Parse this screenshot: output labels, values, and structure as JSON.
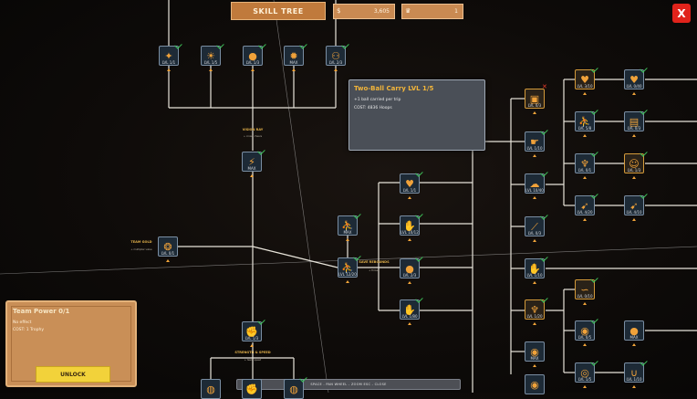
{
  "header": {
    "skill_tree_label": "SKILL TREE",
    "money": "3,605",
    "trophies": "1"
  },
  "colors": {
    "accent": "#f2a53a",
    "node_border": "#7a8ea3",
    "node_bg": "#1d2a36",
    "check": "#3ec35a",
    "close": "#e0231b"
  },
  "close_label": "X",
  "tooltip": {
    "title": "Two-Ball Carry   LVL 1/5",
    "desc": "+1 ball carried per trip",
    "cost": "COST: 4836 Hoops"
  },
  "team_power": {
    "title": "Team Power  0/1",
    "effect": "No effect",
    "cost": "COST: 1 Trophy",
    "button": "UNLOCK"
  },
  "hint": "SPACE - PAN     WHEEL - ZOOM     ESC - CLOSE",
  "captions": [
    {
      "id": "vision",
      "title": "VISION RAY",
      "sub": "+ crowd cheers"
    },
    {
      "id": "team",
      "title": "TEAM GOLD",
      "sub": "+ multiplier value"
    },
    {
      "id": "save",
      "title": "SAVE REBOUNDS",
      "sub": "+ throws"
    },
    {
      "id": "strength",
      "title": "STRENGTH & SPEED",
      "sub": "+ team speed"
    }
  ],
  "nodes": [
    {
      "id": "n1",
      "icon": "star-icon",
      "glyph": "✦",
      "lvl": "LVL 1/1",
      "check": true
    },
    {
      "id": "n2",
      "icon": "sun-icon",
      "glyph": "☀",
      "lvl": "LVL 1/5",
      "check": true
    },
    {
      "id": "n3",
      "icon": "basketball-icon",
      "glyph": "●",
      "lvl": "LVL 1/3",
      "check": true
    },
    {
      "id": "n4",
      "icon": "fire-ball-icon",
      "glyph": "✹",
      "lvl": "MAX",
      "check": true
    },
    {
      "id": "n5",
      "icon": "double-ball-icon",
      "glyph": "⚇",
      "lvl": "LVL 2/3",
      "check": true
    },
    {
      "id": "n6",
      "icon": "lightning-icon",
      "glyph": "⚡",
      "lvl": "MAX",
      "check": true
    },
    {
      "id": "n7",
      "icon": "coins-icon",
      "glyph": "❂",
      "lvl": "LVL 0/1",
      "check": false
    },
    {
      "id": "n8",
      "icon": "running-player-icon",
      "glyph": "⛹",
      "lvl": "LVL 12/20",
      "check": true
    },
    {
      "id": "n9",
      "icon": "flexing-arm-icon",
      "glyph": "✊",
      "lvl": "LVL 1/3",
      "check": true
    },
    {
      "id": "n10",
      "icon": "hoop-icon",
      "glyph": "◍",
      "lvl": "",
      "check": false
    },
    {
      "id": "n11",
      "icon": "fist-icon",
      "glyph": "✊",
      "lvl": "",
      "check": false
    },
    {
      "id": "n12",
      "icon": "hoop-icon",
      "glyph": "◍",
      "lvl": "",
      "check": true
    },
    {
      "id": "c1",
      "icon": "basket-icon",
      "glyph": "♥",
      "lvl": "LVL 1/1",
      "check": true
    },
    {
      "id": "c2",
      "icon": "runner-icon",
      "glyph": "⛹",
      "lvl": "MAX",
      "check": true
    },
    {
      "id": "c3",
      "icon": "hand-ball-icon",
      "glyph": "✋",
      "lvl": "LVL 10/12",
      "check": true
    },
    {
      "id": "c4",
      "icon": "ball-icon",
      "glyph": "●",
      "lvl": "LVL 2/3",
      "check": true
    },
    {
      "id": "c5",
      "icon": "hands-icon",
      "glyph": "✋",
      "lvl": "LVL 1/80",
      "check": true
    },
    {
      "id": "d1",
      "icon": "treasure-icon",
      "glyph": "▣",
      "lvl": "LVL 0/3",
      "check": false,
      "x": true
    },
    {
      "id": "d2",
      "icon": "pointing-hand-icon",
      "glyph": "☛",
      "lvl": "LVL 1/10",
      "check": true
    },
    {
      "id": "d3",
      "icon": "cloud-ball-icon",
      "glyph": "☁",
      "lvl": "LVL 10/40",
      "check": true
    },
    {
      "id": "d4",
      "icon": "bat-icon",
      "glyph": "⟋",
      "lvl": "LVL 0/3",
      "check": true
    },
    {
      "id": "d5",
      "icon": "hand-ball-icon",
      "glyph": "✋",
      "lvl": "LVL 1/10",
      "check": true
    },
    {
      "id": "d6",
      "icon": "torch-icon",
      "glyph": "♆",
      "lvl": "LVL 1/20",
      "check": true
    },
    {
      "id": "d7",
      "icon": "silver-ball-icon",
      "glyph": "◉",
      "lvl": "MAX",
      "check": false
    },
    {
      "id": "d8",
      "icon": "silver-ball-icon",
      "glyph": "◉",
      "lvl": "",
      "check": false
    },
    {
      "id": "e1",
      "icon": "fire-hoop-icon",
      "glyph": "♥",
      "lvl": "LVL 3/10",
      "check": true
    },
    {
      "id": "e2",
      "icon": "player-icon",
      "glyph": "⛹",
      "lvl": "LVL 5/8",
      "check": true
    },
    {
      "id": "e3",
      "icon": "torch-icon",
      "glyph": "♆",
      "lvl": "LVL 0/1",
      "check": true
    },
    {
      "id": "e4",
      "icon": "rocket-ball-icon",
      "glyph": "➹",
      "lvl": "LVL 4/20",
      "check": true
    },
    {
      "id": "e5",
      "icon": "worm-icon",
      "glyph": "∽",
      "lvl": "LVL 0/10",
      "check": true
    },
    {
      "id": "e6",
      "icon": "silver-ball-icon",
      "glyph": "◉",
      "lvl": "LVL 0/5",
      "check": true
    },
    {
      "id": "e7",
      "icon": "ball-chain-icon",
      "glyph": "◎",
      "lvl": "LVL 1/5",
      "check": true
    },
    {
      "id": "f1",
      "icon": "fire-hoop-icon",
      "glyph": "♥",
      "lvl": "LVL 0/40",
      "check": true
    },
    {
      "id": "f2",
      "icon": "bench-icon",
      "glyph": "▤",
      "lvl": "LVL 0/3",
      "check": true
    },
    {
      "id": "f3",
      "icon": "crowd-icon",
      "glyph": "☺",
      "lvl": "LVL 1/3",
      "check": true
    },
    {
      "id": "f4",
      "icon": "rocket-ball-icon",
      "glyph": "➹",
      "lvl": "LVL 4/10",
      "check": true
    },
    {
      "id": "f5",
      "icon": "basketball-icon",
      "glyph": "●",
      "lvl": "MAX",
      "check": false
    },
    {
      "id": "f6",
      "icon": "magnet-icon",
      "glyph": "∪",
      "lvl": "LVL 1/10",
      "check": true
    }
  ]
}
